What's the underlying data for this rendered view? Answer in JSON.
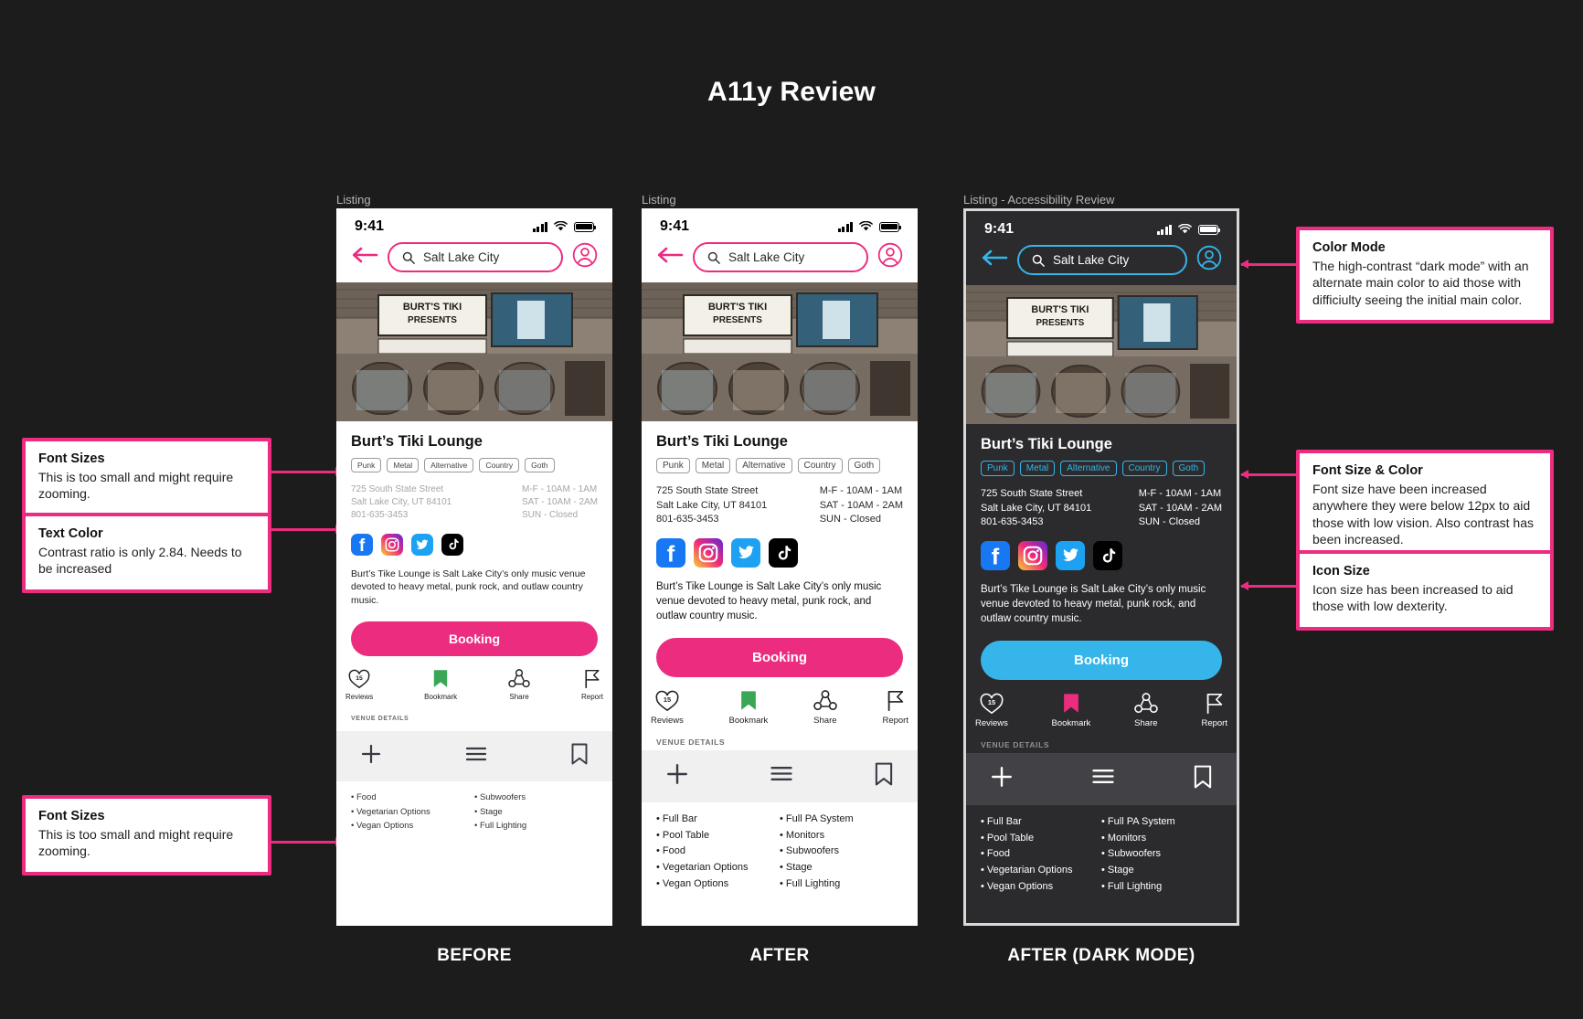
{
  "page": {
    "title": "A11y Review",
    "background": "#1c1c1c"
  },
  "colors": {
    "accent_pink": "#ec2c7f",
    "accent_cyan": "#35b5ea",
    "bookmark_green": "#3aa757",
    "dark_bg": "#2b2b2e",
    "light_bg": "#ffffff"
  },
  "annotations": {
    "left": [
      {
        "title": "Font Sizes",
        "body": "This is too small and might require zooming."
      },
      {
        "title": "Text Color",
        "body": "Contrast ratio is only 2.84. Needs to be increased"
      },
      {
        "title": "Font Sizes",
        "body": "This is too small and might require zooming."
      }
    ],
    "right": [
      {
        "title": "Color Mode",
        "body": "The high-contrast “dark mode”  with an alternate main color to aid those with difficiulty seeing the initial main color."
      },
      {
        "title": "Font Size & Color",
        "body": "Font size have been increased anywhere they were below 12px to aid those with low vision. Also contrast has been increased."
      },
      {
        "title": "Icon Size",
        "body": "Icon size has been increased to aid those with low dexterity."
      }
    ]
  },
  "shared": {
    "status_time": "9:41",
    "search_value": "Salt Lake City",
    "venue_name": "Burt’s Tiki Lounge",
    "tags": [
      "Punk",
      "Metal",
      "Alternative",
      "Country",
      "Goth"
    ],
    "address_lines": [
      "725 South State Street",
      "Salt Lake City, UT 84101",
      "801-635-3453"
    ],
    "hours_lines": [
      "M-F - 10AM - 1AM",
      "SAT - 10AM - 2AM",
      "SUN - Closed"
    ],
    "description": "Burt’s Tike Lounge is Salt Lake City’s only music venue devoted to heavy metal, punk rock, and outlaw country music.",
    "booking_label": "Booking",
    "reviews_count": "15",
    "actions": [
      "Reviews",
      "Bookmark",
      "Share",
      "Report"
    ],
    "socials": [
      "facebook-icon",
      "instagram-icon",
      "twitter-icon",
      "tiktok-icon"
    ],
    "tabbar_icons": [
      "plus-icon",
      "menu-icon",
      "bookmark-outline-icon"
    ],
    "hero_sign_lines": [
      "BURT'S TIKI",
      "PRESENTS"
    ]
  },
  "phones": [
    {
      "window_label": "Listing",
      "caption": "BEFORE",
      "mode": "light",
      "venue_details_label": "VENUE DETAILS",
      "amenities_left": [
        "Food",
        "Vegetarian Options",
        "Vegan Options"
      ],
      "amenities_right": [
        "Subwoofers",
        "Stage",
        "Full Lighting"
      ]
    },
    {
      "window_label": "Listing",
      "caption": "AFTER",
      "mode": "light",
      "venue_details_label": "VENUE DETAILS",
      "amenities_left": [
        "Full Bar",
        "Pool Table",
        "Food",
        "Vegetarian Options",
        "Vegan Options"
      ],
      "amenities_right": [
        "Full PA System",
        "Monitors",
        "Subwoofers",
        "Stage",
        "Full Lighting"
      ]
    },
    {
      "window_label": "Listing - Accessibility Review",
      "caption": "AFTER (DARK MODE)",
      "mode": "dark",
      "venue_details_label": "VENUE DETAILS",
      "amenities_left": [
        "Full Bar",
        "Pool Table",
        "Food",
        "Vegetarian Options",
        "Vegan Options"
      ],
      "amenities_right": [
        "Full PA System",
        "Monitors",
        "Subwoofers",
        "Stage",
        "Full Lighting"
      ]
    }
  ]
}
